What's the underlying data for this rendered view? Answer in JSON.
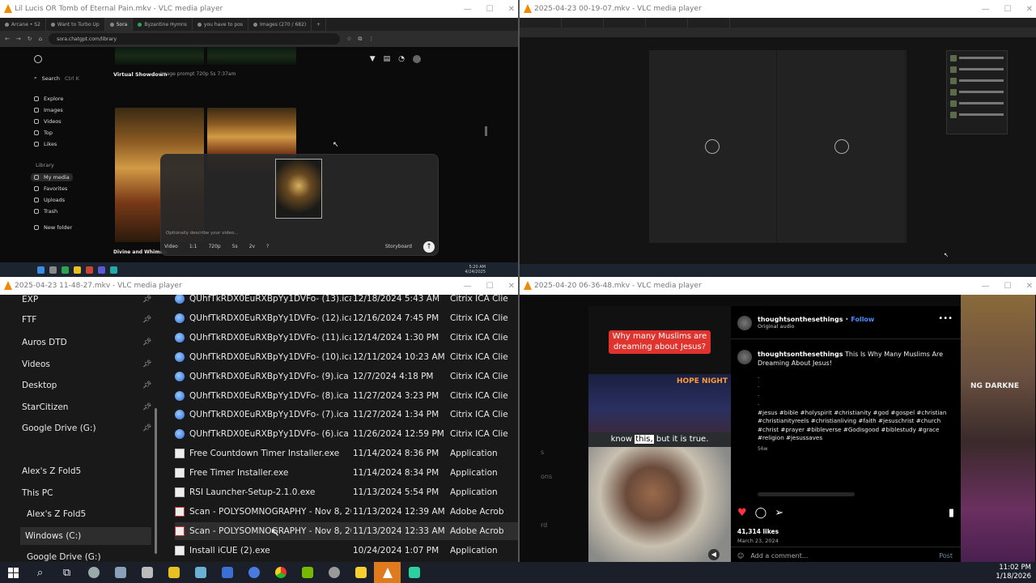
{
  "windows": {
    "top_left": {
      "title": "Lil Lucis OR Tomb of Eternal Pain.mkv - VLC media player",
      "browser": {
        "tabs": [
          "Arcane • S2",
          "Want to Turbo Up",
          "Sora",
          "Byzantine Hymns",
          "you have to pos",
          "Images (270 / 682)"
        ],
        "url": "sora.chatgpt.com/library"
      },
      "sidebar": {
        "search_label": "Search",
        "search_shortcut": "Ctrl K",
        "items": [
          "Explore",
          "Images",
          "Videos",
          "Top",
          "Likes"
        ],
        "library_heading": "Library",
        "library_items": [
          "My media",
          "Favorites",
          "Uploads",
          "Trash"
        ],
        "new_folder": "New folder"
      },
      "gallery": {
        "group_title": "Virtual Showdown",
        "group_meta": "Image prompt  720p  5s  7:37am",
        "group2_title": "Divine and Whimsic"
      },
      "composer": {
        "placeholder": "Optionally describe your video...",
        "toolbar": [
          "Video",
          "1:1",
          "720p",
          "5s",
          "2v",
          "?"
        ],
        "storyboard": "Storyboard",
        "send": "↑"
      },
      "taskbar_time": "5:20 AM",
      "taskbar_date": "4/24/2025"
    },
    "top_right": {
      "title": "2025-04-23 00-19-07.mkv - VLC media player"
    },
    "bottom_left": {
      "title": "2025-04-23 11-48-27.mkv - VLC media player",
      "nav": [
        {
          "label": "EXP",
          "pinned": true
        },
        {
          "label": "FTF",
          "pinned": true
        },
        {
          "label": "Auros DTD",
          "pinned": true
        },
        {
          "label": "Videos",
          "pinned": true
        },
        {
          "label": "Desktop",
          "pinned": true
        },
        {
          "label": "StarCitizen",
          "pinned": true
        },
        {
          "label": "Google Drive (G:)",
          "pinned": true
        },
        {
          "label": "Alex's Z Fold5",
          "pinned": false
        },
        {
          "label": "This PC",
          "pinned": false
        },
        {
          "label": "Alex's Z Fold5",
          "pinned": false
        },
        {
          "label": "Windows (C:)",
          "pinned": false
        },
        {
          "label": "Google Drive (G:)",
          "pinned": false
        }
      ],
      "files": [
        {
          "name": "QUhfTkRDX0EuRXBpYy1DVFo- (13).ica",
          "date": "12/18/2024 5:43 AM",
          "type": "Citrix ICA Clie",
          "kind": "ica"
        },
        {
          "name": "QUhfTkRDX0EuRXBpYy1DVFo- (12).ica",
          "date": "12/16/2024 7:45 PM",
          "type": "Citrix ICA Clie",
          "kind": "ica"
        },
        {
          "name": "QUhfTkRDX0EuRXBpYy1DVFo- (11).ica",
          "date": "12/14/2024 1:30 PM",
          "type": "Citrix ICA Clie",
          "kind": "ica"
        },
        {
          "name": "QUhfTkRDX0EuRXBpYy1DVFo- (10).ica",
          "date": "12/11/2024 10:23 AM",
          "type": "Citrix ICA Clie",
          "kind": "ica"
        },
        {
          "name": "QUhfTkRDX0EuRXBpYy1DVFo- (9).ica",
          "date": "12/7/2024 4:18 PM",
          "type": "Citrix ICA Clie",
          "kind": "ica"
        },
        {
          "name": "QUhfTkRDX0EuRXBpYy1DVFo- (8).ica",
          "date": "11/27/2024 3:23 PM",
          "type": "Citrix ICA Clie",
          "kind": "ica"
        },
        {
          "name": "QUhfTkRDX0EuRXBpYy1DVFo- (7).ica",
          "date": "11/27/2024 1:34 PM",
          "type": "Citrix ICA Clie",
          "kind": "ica"
        },
        {
          "name": "QUhfTkRDX0EuRXBpYy1DVFo- (6).ica",
          "date": "11/26/2024 12:59 PM",
          "type": "Citrix ICA Clie",
          "kind": "ica"
        },
        {
          "name": "Free Countdown Timer Installer.exe",
          "date": "11/14/2024 8:36 PM",
          "type": "Application",
          "kind": "exe"
        },
        {
          "name": "Free Timer Installer.exe",
          "date": "11/14/2024 8:34 PM",
          "type": "Application",
          "kind": "exe"
        },
        {
          "name": "RSI Launcher-Setup-2.1.0.exe",
          "date": "11/13/2024 5:54 PM",
          "type": "Application",
          "kind": "exe"
        },
        {
          "name": "Scan - POLYSOMNOGRAPHY - Nov 8, 20...",
          "date": "11/13/2024 12:39 AM",
          "type": "Adobe Acrob",
          "kind": "pdf"
        },
        {
          "name": "Scan - POLYSOMNOGRAPHY - Nov 8, 20...",
          "date": "11/13/2024 12:33 AM",
          "type": "Adobe Acrob",
          "kind": "pdf"
        },
        {
          "name": "Install iCUE (2).exe",
          "date": "10/24/2024 1:07 PM",
          "type": "Application",
          "kind": "exe"
        }
      ]
    },
    "bottom_right": {
      "title": "2025-04-20 06-36-48.mkv - VLC media player",
      "left_fragments": [
        "s",
        "ons",
        "rd"
      ],
      "video": {
        "banner": "Why many Muslims are dreaming about Jesus?",
        "logo": "HOPE NIGHT",
        "caption_before": "know",
        "caption_highlight": "this,",
        "caption_after": "but it is true."
      },
      "right_text": "NG DARKNE",
      "post": {
        "username": "thoughtsonthesethings",
        "follow": "Follow",
        "audio": "Original audio",
        "caption_title": "This Is Why Many Muslims Are Dreaming About Jesus!",
        "dots": [
          ".",
          ".",
          ".",
          "."
        ],
        "hashtags": "#jesus #bible #holyspirit #christianity #god #gospel #christian #christianityreels #christianliving #faith #jesuschrist #church #christ #prayer #bibleverse #Godisgood #biblestudy #grace #religion #jesussaves",
        "age": "56w",
        "likes": "41,314 likes",
        "date": "March 23, 2024",
        "comment_placeholder": "Add a comment...",
        "post_button": "Post"
      }
    }
  },
  "taskbar": {
    "time": "11:02 PM",
    "date": "1/18/2026"
  },
  "colors": {
    "vlc_orange": "#f08a00",
    "banner_red": "#e0332e",
    "like_red": "#ff3040",
    "follow_blue": "#4c8dff",
    "taskbar_active": "#e07a1f"
  }
}
